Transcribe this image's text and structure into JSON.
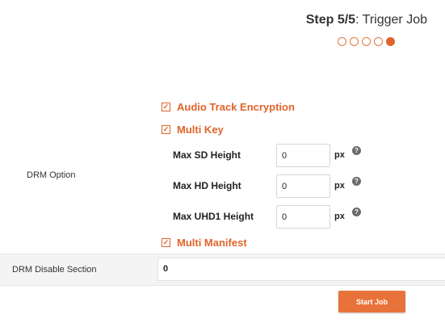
{
  "header": {
    "step_number": "Step 5/5",
    "step_name": ": Trigger Job",
    "total_steps": 5,
    "current_step": 5
  },
  "drm_option": {
    "label": "DRM Option",
    "audio_track_encryption": {
      "label": "Audio Track Encryption",
      "checked": true
    },
    "multi_key": {
      "label": "Multi Key",
      "checked": true,
      "fields": [
        {
          "label": "Max SD Height",
          "value": "0",
          "unit": "px",
          "help": "?"
        },
        {
          "label": "Max HD Height",
          "value": "0",
          "unit": "px",
          "help": "?"
        },
        {
          "label": "Max UHD1 Height",
          "value": "0",
          "unit": "px",
          "help": "?"
        }
      ]
    },
    "multi_manifest": {
      "label": "Multi Manifest",
      "checked": true
    }
  },
  "drm_disable_section": {
    "label": "DRM Disable Section",
    "value": "0"
  },
  "actions": {
    "start_job_label": "Start Job"
  },
  "colors": {
    "accent": "#e0642a",
    "button": "#e8733a",
    "row_bg": "#f4f4f4"
  },
  "icons": {
    "checkbox": "checkmark-icon",
    "help": "question-circle-icon"
  }
}
